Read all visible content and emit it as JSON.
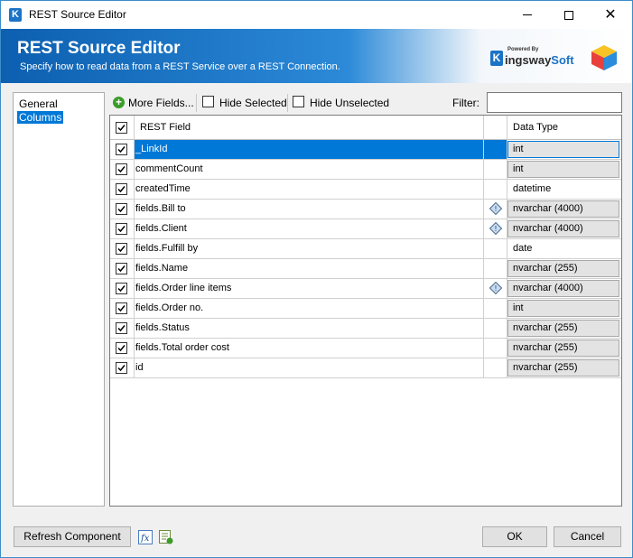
{
  "window": {
    "title": "REST Source Editor"
  },
  "banner": {
    "title": "REST Source Editor",
    "subtitle": "Specify how to read data from a REST Service over a REST Connection.",
    "logo_powered": "Powered By",
    "logo_name_part1": "ingsway",
    "logo_name_part2": "Soft"
  },
  "sidebar": {
    "items": [
      {
        "label": "General",
        "selected": false
      },
      {
        "label": "Columns",
        "selected": true
      }
    ]
  },
  "toolbar": {
    "more_fields_label": "More Fields...",
    "hide_selected_label": "Hide Selected",
    "hide_unselected_label": "Hide Unselected",
    "filter_label": "Filter:",
    "filter_value": ""
  },
  "grid": {
    "columns": [
      "REST Field",
      "Data Type"
    ],
    "rows": [
      {
        "checked": true,
        "field": "_LinkId",
        "warning": false,
        "type": "int",
        "readonly": true,
        "selected": true
      },
      {
        "checked": true,
        "field": "commentCount",
        "warning": false,
        "type": "int",
        "readonly": true,
        "selected": false
      },
      {
        "checked": true,
        "field": "createdTime",
        "warning": false,
        "type": "datetime",
        "readonly": false,
        "selected": false
      },
      {
        "checked": true,
        "field": "fields.Bill to",
        "warning": true,
        "type": "nvarchar (4000)",
        "readonly": true,
        "selected": false
      },
      {
        "checked": true,
        "field": "fields.Client",
        "warning": true,
        "type": "nvarchar (4000)",
        "readonly": true,
        "selected": false
      },
      {
        "checked": true,
        "field": "fields.Fulfill by",
        "warning": false,
        "type": "date",
        "readonly": false,
        "selected": false
      },
      {
        "checked": true,
        "field": "fields.Name",
        "warning": false,
        "type": "nvarchar (255)",
        "readonly": true,
        "selected": false
      },
      {
        "checked": true,
        "field": "fields.Order line items",
        "warning": true,
        "type": "nvarchar (4000)",
        "readonly": true,
        "selected": false
      },
      {
        "checked": true,
        "field": "fields.Order no.",
        "warning": false,
        "type": "int",
        "readonly": true,
        "selected": false
      },
      {
        "checked": true,
        "field": "fields.Status",
        "warning": false,
        "type": "nvarchar (255)",
        "readonly": true,
        "selected": false
      },
      {
        "checked": true,
        "field": "fields.Total order cost",
        "warning": false,
        "type": "nvarchar (255)",
        "readonly": true,
        "selected": false
      },
      {
        "checked": true,
        "field": "id",
        "warning": false,
        "type": "nvarchar (255)",
        "readonly": true,
        "selected": false
      }
    ]
  },
  "footer": {
    "refresh_label": "Refresh Component",
    "ok_label": "OK",
    "cancel_label": "Cancel"
  },
  "colors": {
    "accent": "#0078d7",
    "banner_dark": "#0d5fb0",
    "add_icon": "#3b9c2a"
  }
}
